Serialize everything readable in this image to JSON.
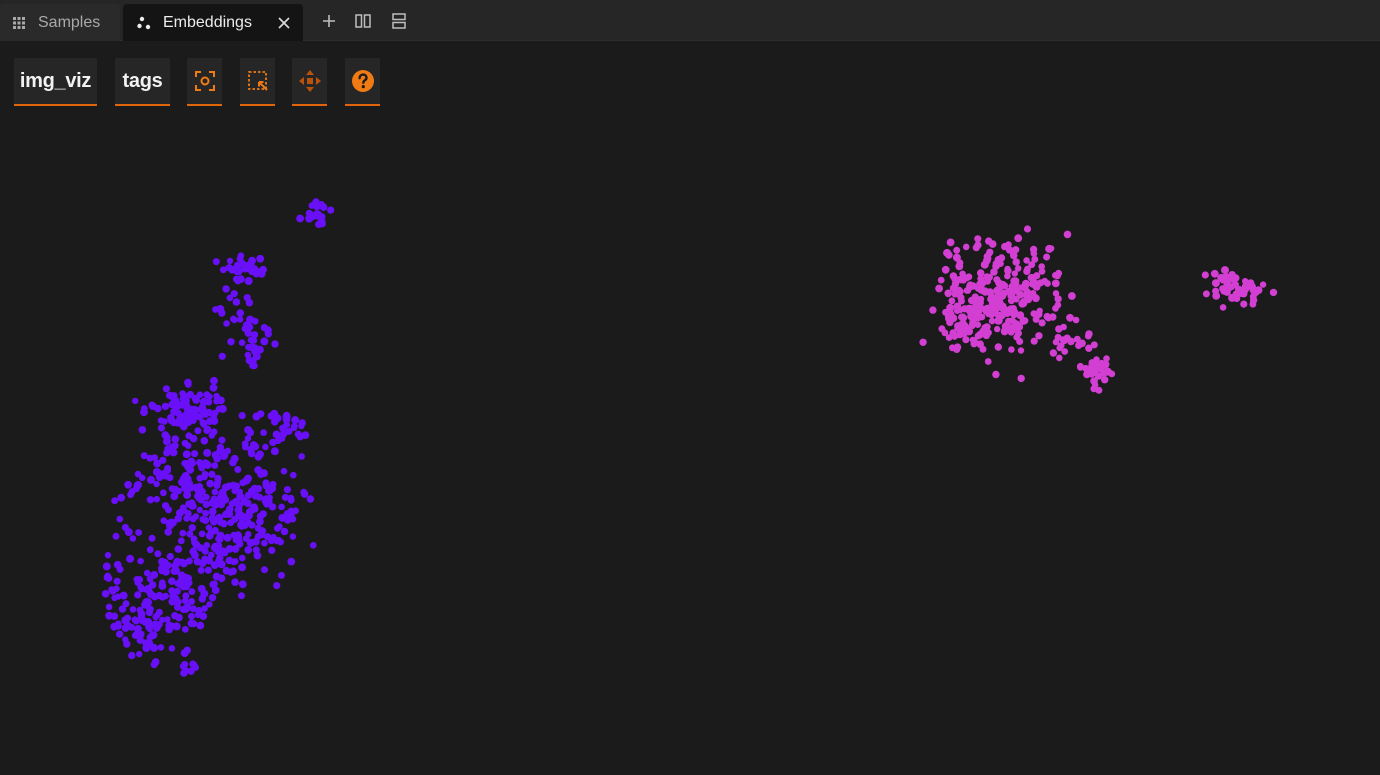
{
  "tabs": [
    {
      "label": "Samples",
      "icon": "grid-icon",
      "active": false
    },
    {
      "label": "Embeddings",
      "icon": "embeddings-icon",
      "active": true
    }
  ],
  "tab_actions": [
    "add-tab-icon",
    "split-horizontal-icon",
    "split-vertical-icon"
  ],
  "toolbar": {
    "brain_key_label": "img_viz",
    "color_by_label": "tags",
    "tools": [
      "lasso-select-icon",
      "box-select-icon",
      "pan-icon",
      "help-icon"
    ]
  },
  "colors": {
    "accent": "#e0650b",
    "cluster_a": "#6a10f8",
    "cluster_b": "#d23fd2",
    "background": "#1b1b1b"
  }
}
